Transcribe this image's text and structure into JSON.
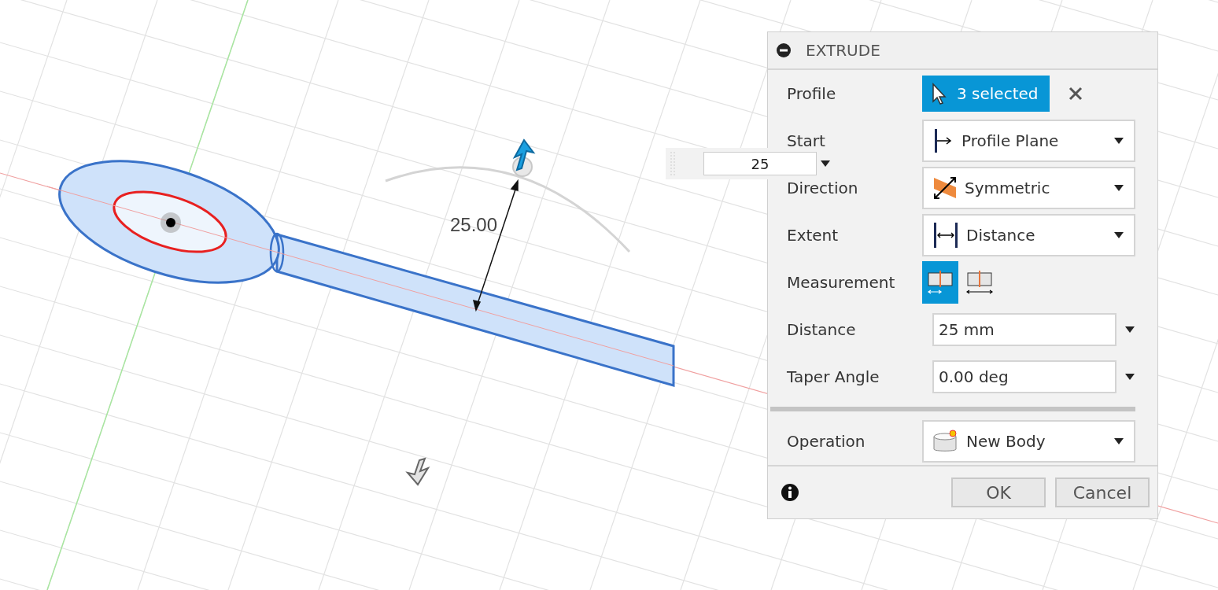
{
  "viewport": {
    "dimension_label": "25.00",
    "distance_input": {
      "value": "25"
    }
  },
  "dialog": {
    "title": "EXTRUDE",
    "rows": [
      {
        "kind": "selection",
        "label": "Profile",
        "value": "3 selected"
      },
      {
        "kind": "dropdown",
        "label": "Start",
        "value": "Profile Plane"
      },
      {
        "kind": "dropdown",
        "label": "Direction",
        "value": "Symmetric"
      },
      {
        "kind": "dropdown",
        "label": "Extent",
        "value": "Distance"
      },
      {
        "kind": "toggle",
        "label": "Measurement",
        "options": [
          {
            "selected": true
          },
          {
            "selected": false
          }
        ]
      },
      {
        "kind": "value",
        "label": "Distance",
        "value": "25 mm"
      },
      {
        "kind": "value",
        "label": "Taper Angle",
        "value": "0.00 deg"
      },
      {
        "kind": "separator"
      },
      {
        "kind": "dropdown",
        "label": "Operation",
        "value": "New Body"
      }
    ],
    "buttons": [
      "OK",
      "Cancel"
    ]
  }
}
